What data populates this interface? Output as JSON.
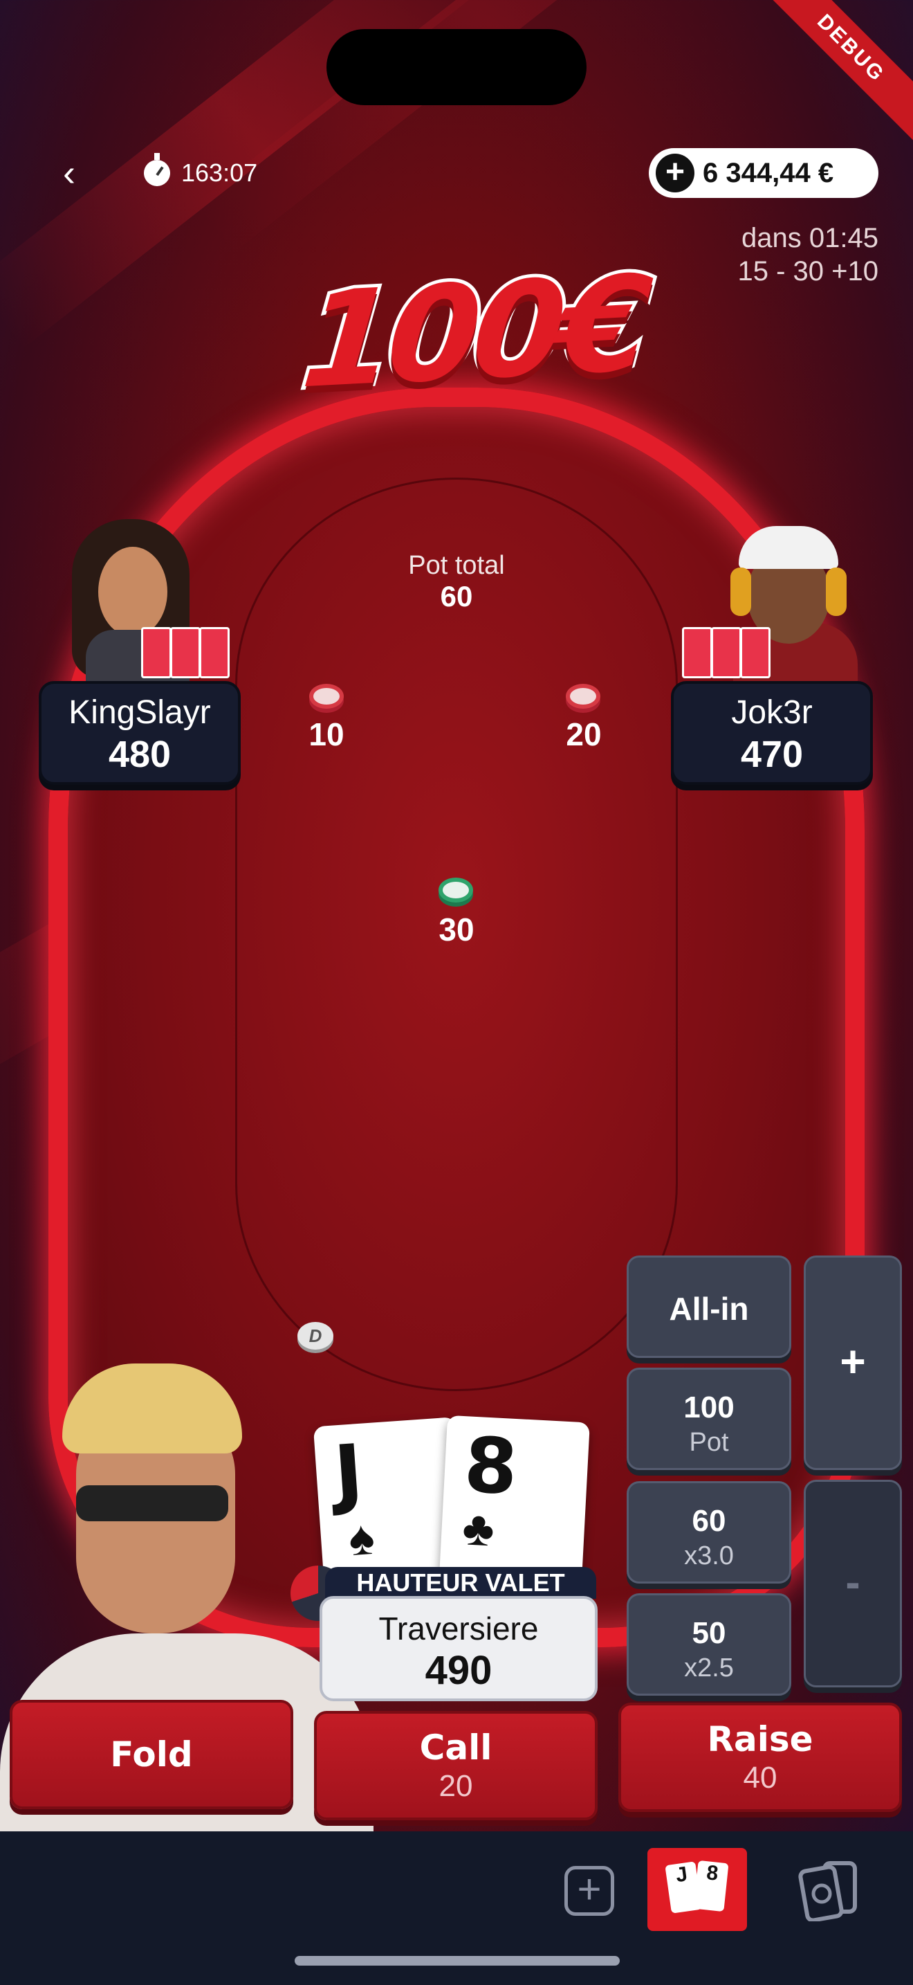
{
  "status": {
    "debug_label": "DEBUG"
  },
  "header": {
    "back_icon": "chevron-left-icon",
    "timer_icon": "stopwatch-icon",
    "elapsed": "163:07",
    "balance": "6 344,44 €",
    "add_funds_icon": "plus-circle-icon"
  },
  "tournament": {
    "next_level": "dans 01:45",
    "blinds": "15 - 30 +10",
    "prize": "100€"
  },
  "pot": {
    "label": "Pot total",
    "value": "60"
  },
  "opponents": [
    {
      "name": "KingSlayr",
      "stack": "480",
      "bet": "10"
    },
    {
      "name": "Jok3r",
      "stack": "470",
      "bet": "20"
    }
  ],
  "hero": {
    "name": "Traversiere",
    "stack": "490",
    "bet": "30",
    "hand_label": "HAUTEUR VALET",
    "cards": [
      {
        "rank": "J",
        "suit": "♠"
      },
      {
        "rank": "8",
        "suit": "♣"
      }
    ],
    "dealer_label": "D"
  },
  "raise_panel": {
    "all_in": "All-in",
    "pot_value": "100",
    "pot_label": "Pot",
    "x3_value": "60",
    "x3_label": "x3.0",
    "x25_value": "50",
    "x25_label": "x2.5",
    "increase": "+",
    "decrease": "-"
  },
  "actions": {
    "fold": "Fold",
    "call": "Call",
    "call_amount": "20",
    "raise": "Raise",
    "raise_amount": "40"
  },
  "bottom_nav": {
    "add_icon": "plus-square-icon",
    "hand_icon": "cards-icon",
    "history_icon": "card-history-icon",
    "mini_cards": [
      "J",
      "8"
    ]
  },
  "colors": {
    "accent": "#e01b24",
    "table": "#8a1016",
    "panel": "#3c4252",
    "nav": "#131929"
  }
}
